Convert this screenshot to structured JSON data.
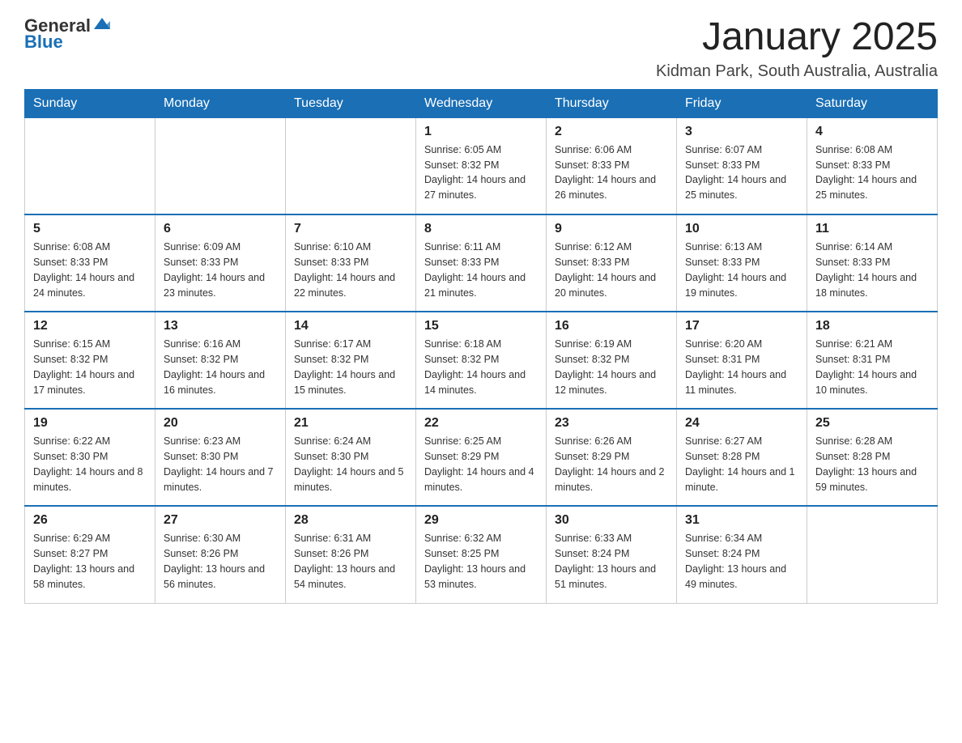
{
  "logo": {
    "general": "General",
    "blue": "Blue"
  },
  "title": "January 2025",
  "subtitle": "Kidman Park, South Australia, Australia",
  "days_of_week": [
    "Sunday",
    "Monday",
    "Tuesday",
    "Wednesday",
    "Thursday",
    "Friday",
    "Saturday"
  ],
  "weeks": [
    [
      {
        "day": "",
        "info": ""
      },
      {
        "day": "",
        "info": ""
      },
      {
        "day": "",
        "info": ""
      },
      {
        "day": "1",
        "info": "Sunrise: 6:05 AM\nSunset: 8:32 PM\nDaylight: 14 hours and 27 minutes."
      },
      {
        "day": "2",
        "info": "Sunrise: 6:06 AM\nSunset: 8:33 PM\nDaylight: 14 hours and 26 minutes."
      },
      {
        "day": "3",
        "info": "Sunrise: 6:07 AM\nSunset: 8:33 PM\nDaylight: 14 hours and 25 minutes."
      },
      {
        "day": "4",
        "info": "Sunrise: 6:08 AM\nSunset: 8:33 PM\nDaylight: 14 hours and 25 minutes."
      }
    ],
    [
      {
        "day": "5",
        "info": "Sunrise: 6:08 AM\nSunset: 8:33 PM\nDaylight: 14 hours and 24 minutes."
      },
      {
        "day": "6",
        "info": "Sunrise: 6:09 AM\nSunset: 8:33 PM\nDaylight: 14 hours and 23 minutes."
      },
      {
        "day": "7",
        "info": "Sunrise: 6:10 AM\nSunset: 8:33 PM\nDaylight: 14 hours and 22 minutes."
      },
      {
        "day": "8",
        "info": "Sunrise: 6:11 AM\nSunset: 8:33 PM\nDaylight: 14 hours and 21 minutes."
      },
      {
        "day": "9",
        "info": "Sunrise: 6:12 AM\nSunset: 8:33 PM\nDaylight: 14 hours and 20 minutes."
      },
      {
        "day": "10",
        "info": "Sunrise: 6:13 AM\nSunset: 8:33 PM\nDaylight: 14 hours and 19 minutes."
      },
      {
        "day": "11",
        "info": "Sunrise: 6:14 AM\nSunset: 8:33 PM\nDaylight: 14 hours and 18 minutes."
      }
    ],
    [
      {
        "day": "12",
        "info": "Sunrise: 6:15 AM\nSunset: 8:32 PM\nDaylight: 14 hours and 17 minutes."
      },
      {
        "day": "13",
        "info": "Sunrise: 6:16 AM\nSunset: 8:32 PM\nDaylight: 14 hours and 16 minutes."
      },
      {
        "day": "14",
        "info": "Sunrise: 6:17 AM\nSunset: 8:32 PM\nDaylight: 14 hours and 15 minutes."
      },
      {
        "day": "15",
        "info": "Sunrise: 6:18 AM\nSunset: 8:32 PM\nDaylight: 14 hours and 14 minutes."
      },
      {
        "day": "16",
        "info": "Sunrise: 6:19 AM\nSunset: 8:32 PM\nDaylight: 14 hours and 12 minutes."
      },
      {
        "day": "17",
        "info": "Sunrise: 6:20 AM\nSunset: 8:31 PM\nDaylight: 14 hours and 11 minutes."
      },
      {
        "day": "18",
        "info": "Sunrise: 6:21 AM\nSunset: 8:31 PM\nDaylight: 14 hours and 10 minutes."
      }
    ],
    [
      {
        "day": "19",
        "info": "Sunrise: 6:22 AM\nSunset: 8:30 PM\nDaylight: 14 hours and 8 minutes."
      },
      {
        "day": "20",
        "info": "Sunrise: 6:23 AM\nSunset: 8:30 PM\nDaylight: 14 hours and 7 minutes."
      },
      {
        "day": "21",
        "info": "Sunrise: 6:24 AM\nSunset: 8:30 PM\nDaylight: 14 hours and 5 minutes."
      },
      {
        "day": "22",
        "info": "Sunrise: 6:25 AM\nSunset: 8:29 PM\nDaylight: 14 hours and 4 minutes."
      },
      {
        "day": "23",
        "info": "Sunrise: 6:26 AM\nSunset: 8:29 PM\nDaylight: 14 hours and 2 minutes."
      },
      {
        "day": "24",
        "info": "Sunrise: 6:27 AM\nSunset: 8:28 PM\nDaylight: 14 hours and 1 minute."
      },
      {
        "day": "25",
        "info": "Sunrise: 6:28 AM\nSunset: 8:28 PM\nDaylight: 13 hours and 59 minutes."
      }
    ],
    [
      {
        "day": "26",
        "info": "Sunrise: 6:29 AM\nSunset: 8:27 PM\nDaylight: 13 hours and 58 minutes."
      },
      {
        "day": "27",
        "info": "Sunrise: 6:30 AM\nSunset: 8:26 PM\nDaylight: 13 hours and 56 minutes."
      },
      {
        "day": "28",
        "info": "Sunrise: 6:31 AM\nSunset: 8:26 PM\nDaylight: 13 hours and 54 minutes."
      },
      {
        "day": "29",
        "info": "Sunrise: 6:32 AM\nSunset: 8:25 PM\nDaylight: 13 hours and 53 minutes."
      },
      {
        "day": "30",
        "info": "Sunrise: 6:33 AM\nSunset: 8:24 PM\nDaylight: 13 hours and 51 minutes."
      },
      {
        "day": "31",
        "info": "Sunrise: 6:34 AM\nSunset: 8:24 PM\nDaylight: 13 hours and 49 minutes."
      },
      {
        "day": "",
        "info": ""
      }
    ]
  ]
}
